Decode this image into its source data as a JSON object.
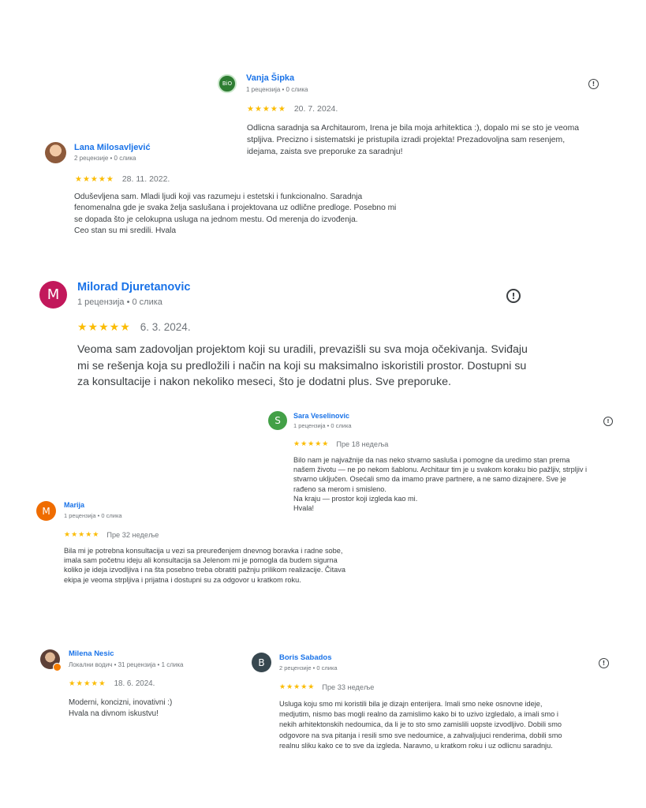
{
  "colors": {
    "name": "#1a73e8",
    "star": "#fbbc04",
    "meta": "#70757a",
    "text": "#3c4043"
  },
  "icons": {
    "report": "exclamation-circle-icon",
    "star": "star-icon"
  },
  "reviews": [
    {
      "id": "vanja",
      "avatar": {
        "letter": "BiO",
        "color": "#2e7d32",
        "kind": "logo"
      },
      "name": "Vanja Šipka",
      "meta": "1 рецензија • 0 слика",
      "stars": "★★★★★",
      "rating": 5,
      "date": "20. 7. 2024.",
      "text": "Odlicna saradnja sa Architaurom, Irena je bila moja arhitektica :), dopalo mi se sto je veoma\nstpljiva. Precizno i sistematski je pristupila izradi projekta! Prezadovoljna sam resenjem,\nidejama, zaista sve preporuke za saradnju!"
    },
    {
      "id": "lana",
      "avatar": {
        "kind": "photo"
      },
      "name": "Lana Milosavljević",
      "meta": "2 рецензије • 0 слика",
      "stars": "★★★★★",
      "rating": 5,
      "date": "28. 11. 2022.",
      "text": "Oduševljena sam. Mladi ljudi koji vas razumeju i estetski i funkcionalno. Saradnja\nfenomenalna gde je svaka želja saslušana i projektovana uz odlične predloge. Posebno mi\nse dopada što je celokupna usluga na jednom mestu. Od merenja do izvođenja.\nCeo stan su mi sredili. Hvala"
    },
    {
      "id": "milorad",
      "avatar": {
        "letter": "M",
        "color": "#c2185b"
      },
      "name": "Milorad Djuretanovic",
      "meta": "1 рецензија • 0 слика",
      "stars": "★★★★★",
      "rating": 5,
      "date": "6. 3. 2024.",
      "text": "Veoma sam zadovoljan projektom koji su uradili, prevazišli su sva moja očekivanja. Sviđaju\nmi se rešenja koja su predložili i način na koji su maksimalno iskoristili prostor. Dostupni su\nza konsultacije i nakon nekoliko meseci, što je dodatni plus. Sve preporuke."
    },
    {
      "id": "sara",
      "avatar": {
        "letter": "S",
        "color": "#43a047"
      },
      "name": "Sara Veselinovic",
      "meta": "1 рецензија • 0 слика",
      "stars": "★★★★★",
      "rating": 5,
      "date": "Пре 18 недеља",
      "text": "Bilo nam je najvažnije da nas neko stvarno sasluša i pomogne da uredimo stan prema\nnašem životu — ne po nekom šablonu. Architaur tim je u svakom koraku bio pažljiv, strpljiv i\nstvarno uključen. Osećali smo da imamo prave partnere, a ne samo dizajnere. Sve je\nrađeno sa merom i smisleno.\nNa kraju — prostor koji izgleda kao mi.\nHvala!"
    },
    {
      "id": "marija",
      "avatar": {
        "letter": "M",
        "color": "#ef6c00"
      },
      "name": "Marija",
      "meta": "1 рецензија • 0 слика",
      "stars": "★★★★★",
      "rating": 5,
      "date": "Пре 32 недеље",
      "text": "Bila mi je potrebna konsultacija u vezi sa preuređenjem dnevnog boravka i radne sobe,\nimala sam početnu ideju ali konsultacija sa Jelenom mi je pomogla da budem sigurna\nkoliko je ideja izvodljiva i na šta posebno treba obratiti pažnju prilikom realizacije. Čitava\nekipa je veoma strpljiva i prijatna i dostupni su za odgovor u kratkom roku."
    },
    {
      "id": "milena",
      "avatar": {
        "kind": "photo"
      },
      "name": "Milena Nesic",
      "meta": "Локални водич • 31 рецензија • 1 слика",
      "stars": "★★★★★",
      "rating": 5,
      "date": "18. 6. 2024.",
      "text": "Moderni, koncizni, inovativni :)\nHvala na divnom iskustvu!"
    },
    {
      "id": "boris",
      "avatar": {
        "letter": "B",
        "color": "#37474f"
      },
      "name": "Boris Sabados",
      "meta": "2 рецензије • 0 слика",
      "stars": "★★★★★",
      "rating": 5,
      "date": "Пре 33 недеље",
      "text": "Usluga koju smo mi koristili bila je dizajn enterijera. Imali smo neke osnovne ideje,\nmedjutim, nismo bas mogli realno da zamislimo kako bi to uzivo izgledalo, a imali smo i\nnekih arhitektonskih nedoumica, da li je to sto smo zamislili uopste izvodljivo. Dobili smo\nodgovore na sva pitanja i resili smo sve nedoumice, a zahvaljujuci renderima, dobili smo\nrealnu sliku kako ce to sve da izgleda. Naravno, u kratkom roku i uz odlicnu saradnju."
    }
  ]
}
